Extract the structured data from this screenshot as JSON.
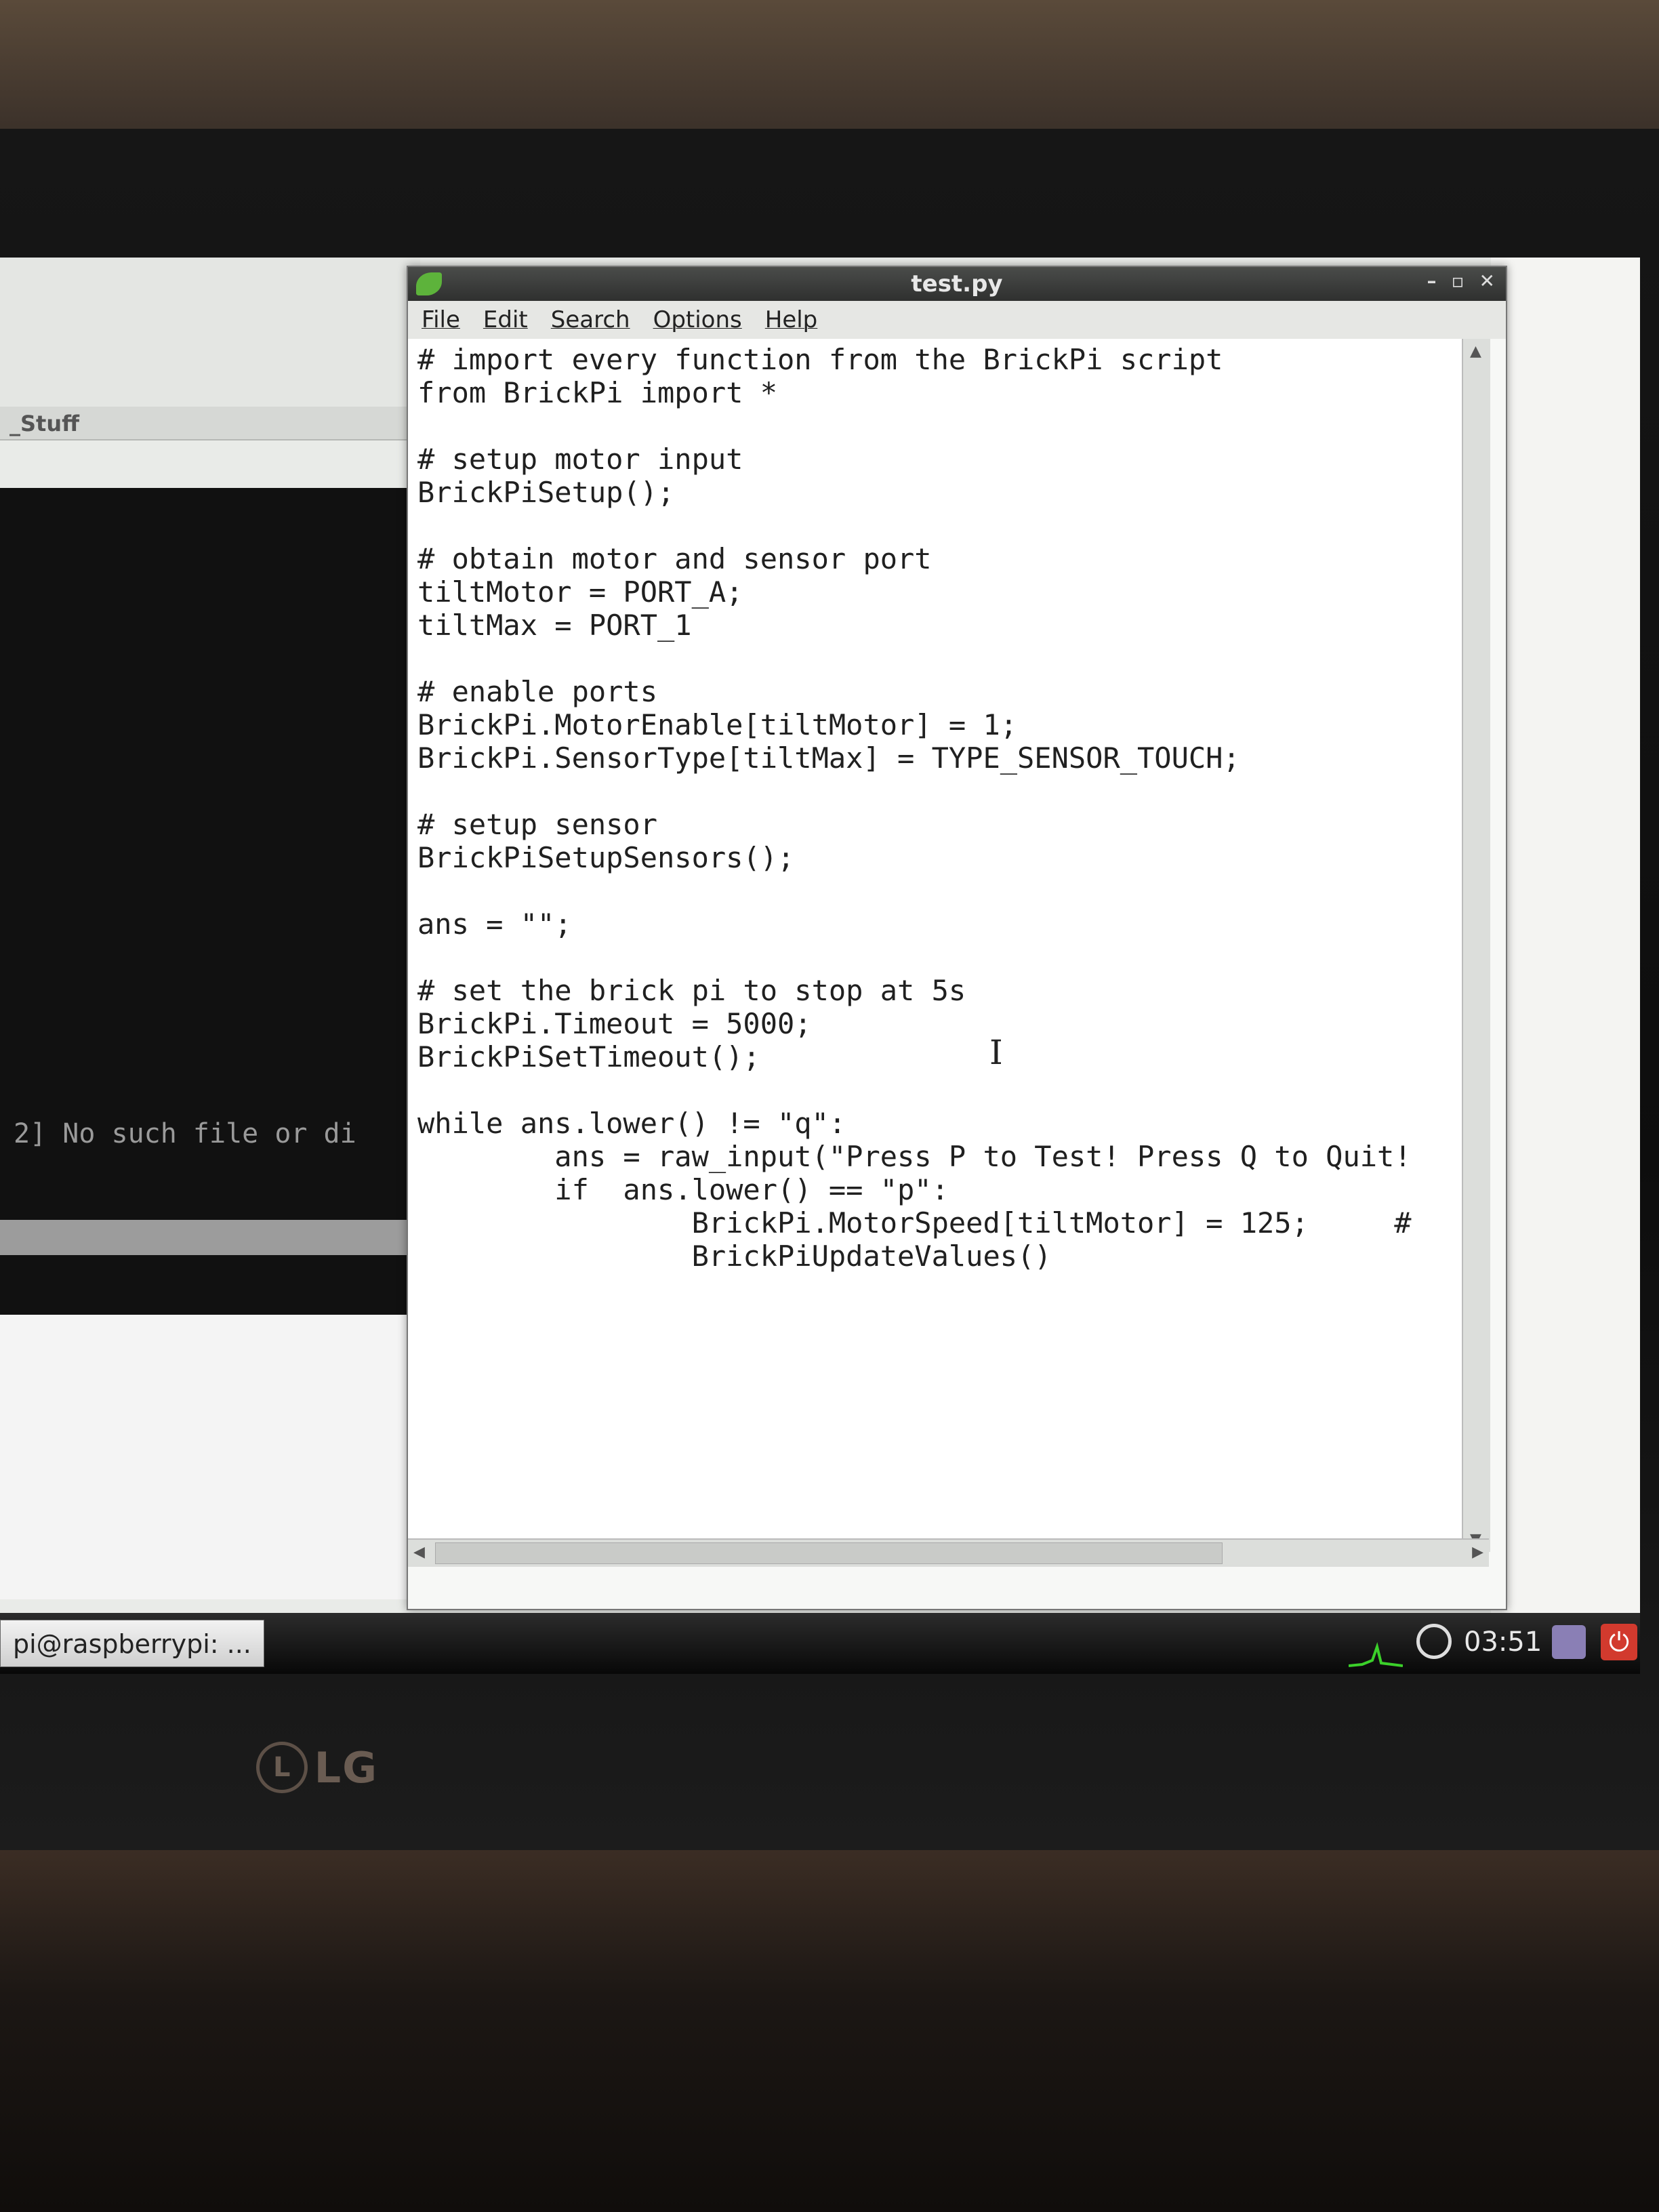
{
  "window": {
    "title": "test.py",
    "controls": [
      "–",
      "▫",
      "✕"
    ]
  },
  "menu": [
    "File",
    "Edit",
    "Search",
    "Options",
    "Help"
  ],
  "editor": {
    "code": "# import every function from the BrickPi script\nfrom BrickPi import *\n\n# setup motor input\nBrickPiSetup();\n\n# obtain motor and sensor port\ntiltMotor = PORT_A;\ntiltMax = PORT_1\n\n# enable ports\nBrickPi.MotorEnable[tiltMotor] = 1;\nBrickPi.SensorType[tiltMax] = TYPE_SENSOR_TOUCH;\n\n# setup sensor\nBrickPiSetupSensors();\n\nans = \"\";\n\n# set the brick pi to stop at 5s\nBrickPi.Timeout = 5000;\nBrickPiSetTimeout();\n\nwhile ans.lower() != \"q\":\n        ans = raw_input(\"Press P to Test! Press Q to Quit!\n        if  ans.lower() == \"p\":\n                BrickPi.MotorSpeed[tiltMotor] = 125;     #\n                BrickPiUpdateValues()"
  },
  "background": {
    "panel_label": "_Stuff",
    "terminal_text": "2] No such file or di"
  },
  "taskbar": {
    "task_label": "pi@raspberrypi: ...",
    "clock": "03:51"
  },
  "monitor": {
    "brand": "LG"
  },
  "colors": {
    "power": "#d23a2e",
    "app_icon": "#5db33b"
  }
}
